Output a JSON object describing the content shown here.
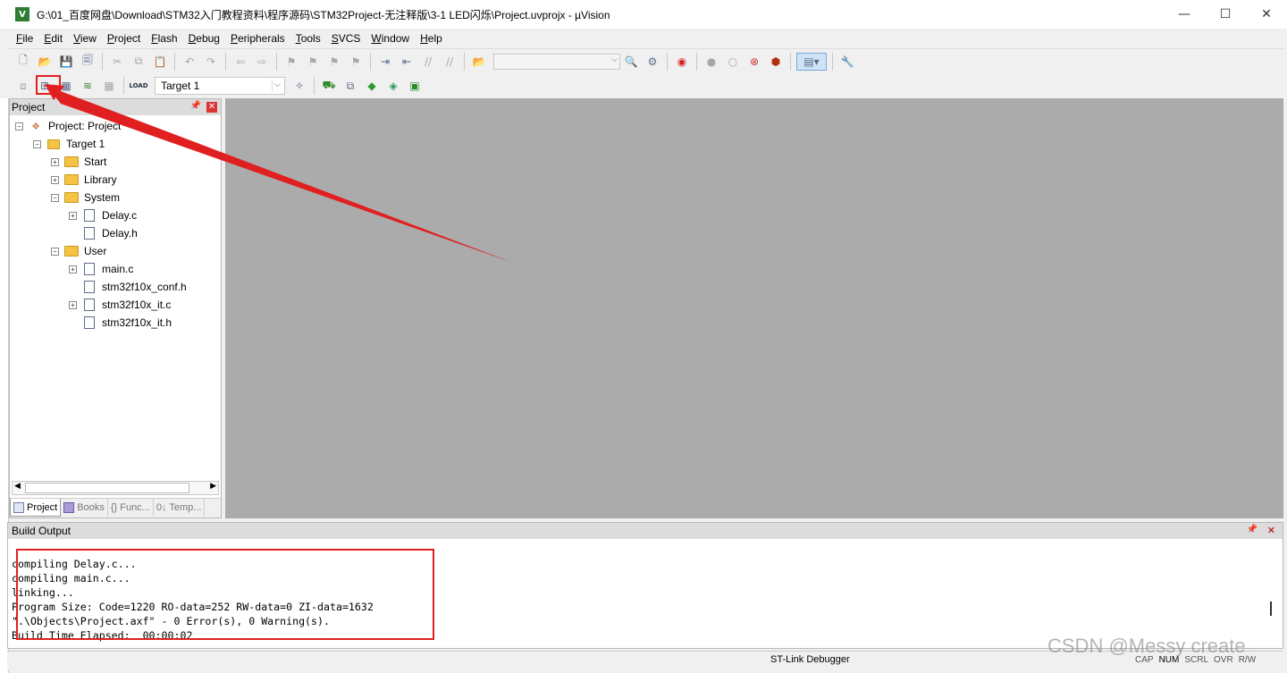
{
  "window": {
    "app_icon": "V",
    "title": "G:\\01_百度网盘\\Download\\STM32入门教程资料\\程序源码\\STM32Project-无注释版\\3-1 LED闪烁\\Project.uvprojx - µVision",
    "controls": [
      "—",
      "☐",
      "✕"
    ]
  },
  "menu": [
    "File",
    "Edit",
    "View",
    "Project",
    "Flash",
    "Debug",
    "Peripherals",
    "Tools",
    "SVCS",
    "Window",
    "Help"
  ],
  "toolbar2": {
    "load_label": "LOAD",
    "target": "Target 1"
  },
  "project_panel": {
    "title": "Project",
    "tree": {
      "root": "Project: Project",
      "target": "Target 1",
      "groups": {
        "start": "Start",
        "library": "Library",
        "system": "System",
        "system_files": [
          "Delay.c",
          "Delay.h"
        ],
        "user": "User",
        "user_files": [
          "main.c",
          "stm32f10x_conf.h",
          "stm32f10x_it.c",
          "stm32f10x_it.h"
        ]
      }
    },
    "tabs": [
      "Project",
      "Books",
      "{} Func...",
      "0↓ Temp..."
    ]
  },
  "build_output": {
    "title": "Build Output",
    "lines": [
      "compiling Delay.c...",
      "compiling main.c...",
      "linking...",
      "Program Size: Code=1220 RO-data=252 RW-data=0 ZI-data=1632",
      "\".\\Objects\\Project.axf\" - 0 Error(s), 0 Warning(s).",
      "Build Time Elapsed:  00:00:02"
    ]
  },
  "status_bar": {
    "debugger": "ST-Link Debugger",
    "flags": [
      "CAP",
      "NUM",
      "SCRL",
      "OVR",
      "R/W"
    ]
  },
  "watermark": "CSDN @Messy create",
  "colors": {
    "annotation_red": "#e02020",
    "editor_bg": "#ababab",
    "panel_header": "#dcdcdc"
  }
}
